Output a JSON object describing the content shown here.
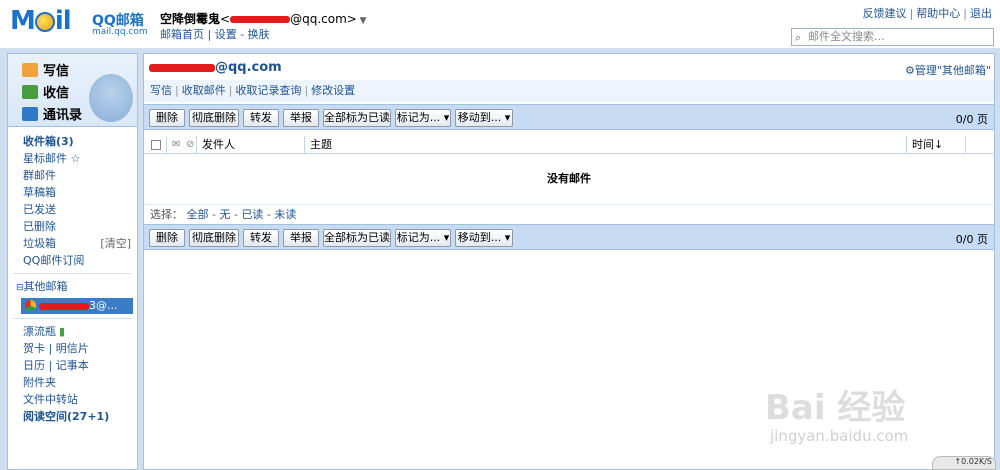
{
  "header": {
    "logo_text": "M",
    "logo_text_after": "il",
    "logo_sub": "QQ邮箱",
    "logo_domain": "mail.qq.com",
    "user_name": "空降倒霉鬼",
    "user_email_prefix": "<",
    "user_email_suffix": "@qq.com>",
    "user_links": [
      "邮箱首页",
      "设置",
      "换肤"
    ],
    "top_links": [
      "反馈建议",
      "帮助中心",
      "退出"
    ],
    "search_placeholder": "邮件全文搜索..."
  },
  "sidebar": {
    "quick": {
      "write": "写信",
      "receive": "收信",
      "contacts": "通讯录"
    },
    "folders": [
      {
        "label": "收件箱(3)",
        "bold": true
      },
      {
        "label": "星标邮件 ☆"
      },
      {
        "label": "群邮件"
      },
      {
        "label": "草稿箱"
      },
      {
        "label": "已发送"
      },
      {
        "label": "已删除"
      },
      {
        "label": "垃圾箱",
        "right": "[清空]"
      },
      {
        "label": "QQ邮件订阅"
      }
    ],
    "other_mailbox_label": "其他邮箱",
    "other_account_suffix": "3@...",
    "extras": [
      {
        "label": "漂流瓶"
      },
      {
        "label": "贺卡  |  明信片"
      },
      {
        "label": "日历  |  记事本"
      },
      {
        "label": "附件夹"
      },
      {
        "label": "文件中转站"
      },
      {
        "label": "阅读空间(27+1)",
        "bold": true
      }
    ]
  },
  "main": {
    "account_title_suffix": "@qq.com",
    "manage_label": "管理\"其他邮箱\"",
    "sublinks": [
      "写信",
      "收取邮件",
      "收取记录查询",
      "修改设置"
    ],
    "toolbar_buttons": [
      "删除",
      "彻底删除",
      "转发",
      "举报",
      "全部标为已读",
      "标记为... ▾",
      "移动到... ▾"
    ],
    "page_info": "0/0 页",
    "columns": {
      "sender": "发件人",
      "subject": "主题",
      "time": "时间↓"
    },
    "empty_message": "没有邮件",
    "select_label": "选择：",
    "select_options": [
      "全部",
      "无",
      "已读",
      "未读"
    ]
  },
  "watermark": {
    "main": "Bai 经验",
    "sub": "jingyan.baidu.com"
  },
  "speed_label": "↑0.02K/S"
}
